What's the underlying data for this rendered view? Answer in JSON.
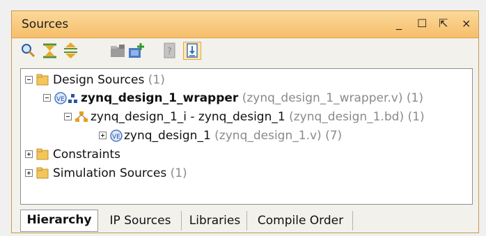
{
  "panel": {
    "title": "Sources",
    "controls": {
      "minimize": "_",
      "maximize": "☐",
      "restore": "⇱",
      "close": "×"
    }
  },
  "toolbar": {
    "buttons": [
      {
        "icon": "search-icon"
      },
      {
        "icon": "collapse-all-icon"
      },
      {
        "icon": "expand-all-icon"
      },
      {
        "icon": "open-folder-icon"
      },
      {
        "icon": "add-sources-icon"
      },
      {
        "icon": "document-icon"
      },
      {
        "icon": "update-icon"
      }
    ]
  },
  "tree": {
    "design_sources": {
      "label": "Design Sources",
      "count": "(1)"
    },
    "wrapper": {
      "label": "zynq_design_1_wrapper",
      "file": "(zynq_design_1_wrapper.v)",
      "count": "(1)"
    },
    "instance": {
      "label": "zynq_design_1_i - zynq_design_1",
      "file": "(zynq_design_1.bd)",
      "count": "(1)"
    },
    "module": {
      "label": "zynq_design_1",
      "file": "(zynq_design_1.v)",
      "count": "(7)"
    },
    "constraints": {
      "label": "Constraints"
    },
    "simulation": {
      "label": "Simulation Sources",
      "count": "(1)"
    }
  },
  "tabs": [
    {
      "label": "Hierarchy",
      "active": true
    },
    {
      "label": "IP Sources"
    },
    {
      "label": "Libraries"
    },
    {
      "label": "Compile Order"
    }
  ],
  "colors": {
    "title_bar": "#f6be6a",
    "border": "#c89a48",
    "verilog_icon": "#4a78c2"
  }
}
